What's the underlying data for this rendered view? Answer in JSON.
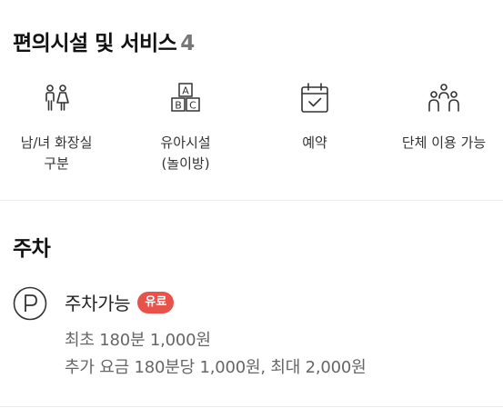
{
  "facilities_section": {
    "title": "편의시설 및 서비스",
    "count": "4",
    "items": [
      {
        "icon": "restroom-icon",
        "label_line1": "남/녀 화장실",
        "label_line2": "구분"
      },
      {
        "icon": "kids-blocks-icon",
        "label_line1": "유아시설",
        "label_line2": "(놀이방)"
      },
      {
        "icon": "calendar-check-icon",
        "label_line1": "예약",
        "label_line2": ""
      },
      {
        "icon": "group-people-icon",
        "label_line1": "단체 이용 가능",
        "label_line2": ""
      }
    ]
  },
  "parking_section": {
    "title": "주차",
    "icon": "parking-icon",
    "status": "주차가능",
    "badge": "유료",
    "fee_lines": [
      "최초 180분 1,000원",
      "추가 요금 180분당 1,000원, 최대 2,000원"
    ]
  },
  "colors": {
    "badge_bg": "#e8524a",
    "title_text": "#111111",
    "secondary_text": "#666666",
    "divider": "#ececec"
  }
}
